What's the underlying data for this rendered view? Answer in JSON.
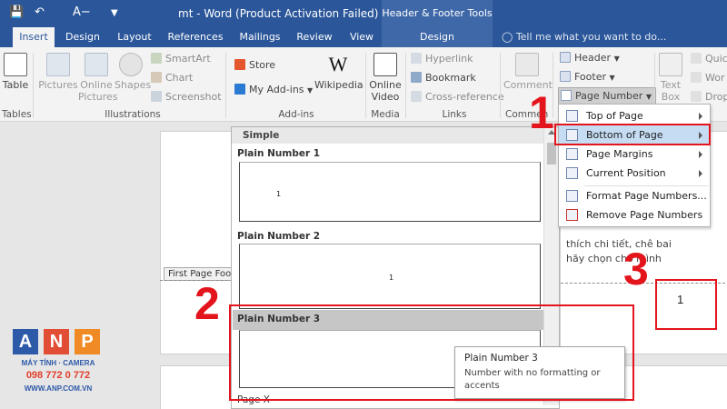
{
  "titlebar": {
    "title": "mt - Word (Product Activation Failed)",
    "tools_label": "Header & Footer Tools"
  },
  "tabs": [
    {
      "label": "Insert"
    },
    {
      "label": "Design"
    },
    {
      "label": "Layout"
    },
    {
      "label": "References"
    },
    {
      "label": "Mailings"
    },
    {
      "label": "Review"
    },
    {
      "label": "View"
    },
    {
      "label": "Design"
    }
  ],
  "tell_me": "Tell me what you want to do...",
  "ribbon": {
    "table": "Table",
    "pictures": "Pictures",
    "online_pictures": "Online Pictures",
    "shapes": "Shapes",
    "smartart": "SmartArt",
    "chart": "Chart",
    "screenshot": "Screenshot",
    "store": "Store",
    "my_addins": "My Add-ins",
    "wikipedia": "Wikipedia",
    "wikipedia_glyph": "W",
    "online_video": "Online Video",
    "hyperlink": "Hyperlink",
    "bookmark": "Bookmark",
    "cross_reference": "Cross-reference",
    "comment": "Comment",
    "header": "Header",
    "footer": "Footer",
    "page_number": "Page Number",
    "text_box": "Text Box",
    "quick": "Quic",
    "wordart": "Wor",
    "dropcap": "Drop",
    "groups": {
      "tables": "Tables",
      "illustrations": "Illustrations",
      "addins": "Add-ins",
      "media": "Media",
      "links": "Links",
      "comments": "Commen"
    }
  },
  "menu": {
    "items": [
      {
        "label": "Top of Page",
        "submenu": true
      },
      {
        "label": "Bottom of Page",
        "submenu": true
      },
      {
        "label": "Page Margins",
        "submenu": true
      },
      {
        "label": "Current Position",
        "submenu": true
      },
      {
        "label": "Format Page Numbers...",
        "submenu": false
      },
      {
        "label": "Remove Page Numbers",
        "submenu": false
      }
    ]
  },
  "gallery": {
    "heading": "Simple",
    "items": [
      {
        "label": "Plain Number 1",
        "number": "1"
      },
      {
        "label": "Plain Number 2",
        "number": "1"
      },
      {
        "label": "Plain Number 3",
        "number": ""
      }
    ],
    "below": "Page X"
  },
  "tooltip": {
    "title": "Plain Number 3",
    "desc": "Number with no formatting or accents"
  },
  "document": {
    "footer_tag": "First Page Foote",
    "text_line1": "thích chi tiết, chê bai",
    "text_line2": "hãy chọn cho mình",
    "page_number": "1"
  },
  "annotations": {
    "one": "1",
    "two": "2",
    "three": "3"
  },
  "logo": {
    "letters": [
      "A",
      "N",
      "P"
    ],
    "line1": "MÁY TÍNH · CAMERA",
    "phone": "098 772 0 772",
    "site": "WWW.ANP.COM.VN"
  },
  "colors": {
    "word_blue": "#2b579a",
    "annotation_red": "#e3141b",
    "menu_highlight": "#c5dcf3"
  }
}
